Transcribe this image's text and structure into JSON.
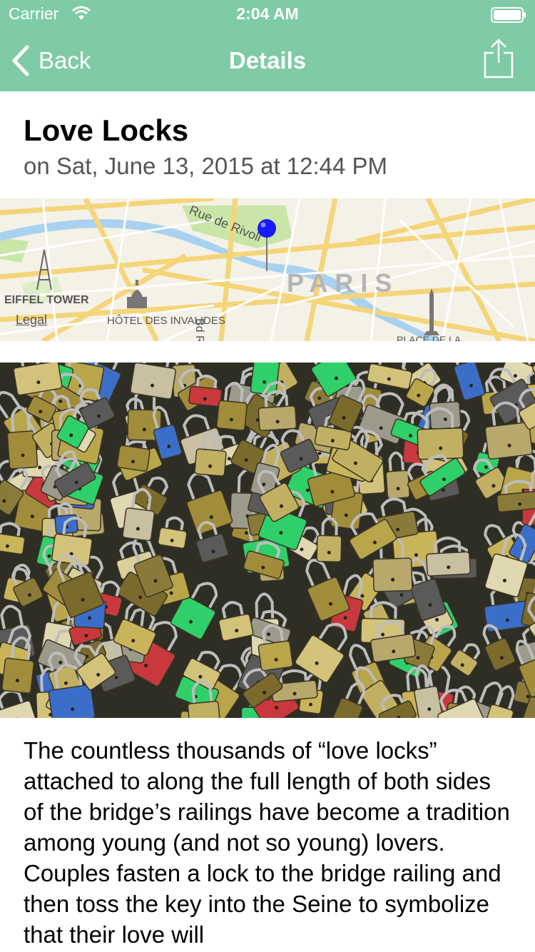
{
  "status_bar": {
    "carrier": "Carrier",
    "time": "2:04 AM"
  },
  "nav": {
    "back_label": "Back",
    "title": "Details",
    "share_icon": "share-icon",
    "background_color": "#7ecba5"
  },
  "detail": {
    "title": "Love Locks",
    "subtitle": "on Sat, June 13, 2015 at 12:44 PM"
  },
  "map": {
    "labels": {
      "street": "Rue de Rivoli",
      "eiffel": "EIFFEL TOWER",
      "hotel": "HÔTEL DES INVALIDES",
      "paris": "PARIS",
      "bd": "Bd R",
      "place": "PLACE DE LA"
    },
    "legal": "Legal",
    "pin_color": "#1a1aff"
  },
  "photo": {
    "subject": "padlocks on bridge railing"
  },
  "description": "The countless thousands of “love locks” attached to along the full length of both sides of the bridge’s railings have become a tradition among young (and not so young) lovers. Couples fasten a lock to the bridge railing and then toss the key into the Seine to symbolize that their love will"
}
